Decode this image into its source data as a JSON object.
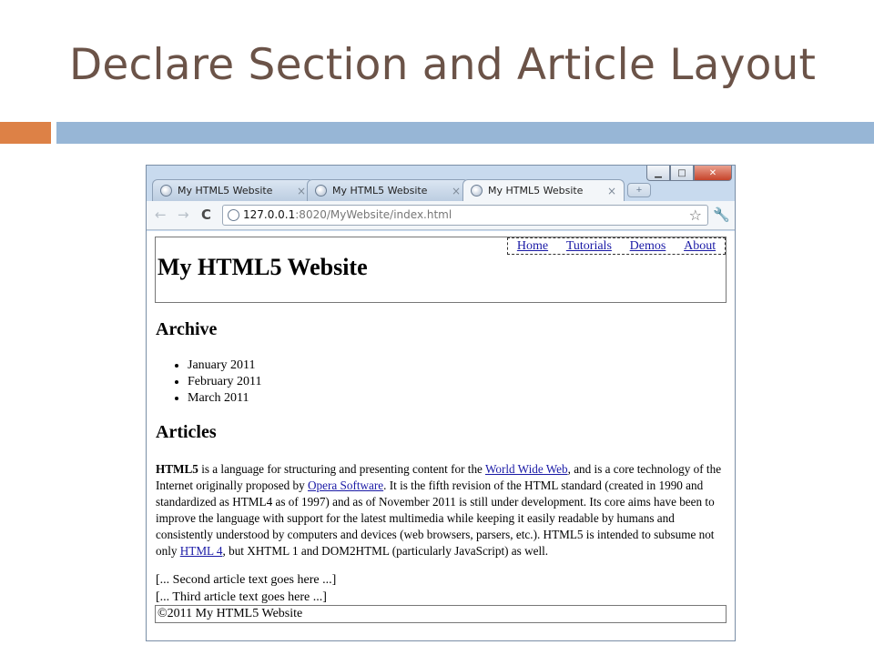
{
  "slide": {
    "title": "Declare Section and Article Layout",
    "colors": {
      "title": "#6b5348",
      "accent_orange": "#dd8146",
      "accent_blue": "#97b6d6"
    }
  },
  "browser": {
    "window_controls": {
      "minimize": "minimize-icon",
      "maximize": "maximize-icon",
      "close": "close-icon"
    },
    "tabs": [
      {
        "label": "My HTML5 Website",
        "active": false,
        "icon": "globe-icon"
      },
      {
        "label": "My HTML5 Website",
        "active": false,
        "icon": "globe-icon"
      },
      {
        "label": "My HTML5 Website",
        "active": true,
        "icon": "globe-icon"
      }
    ],
    "tab_close_glyph": "×",
    "new_tab_glyph": "+",
    "address": {
      "host": "127.0.0.1",
      "rest": ":8020/MyWebsite/index.html"
    },
    "icons": {
      "back": "←",
      "forward": "→",
      "reload": "C",
      "star": "☆",
      "wrench": "🔧"
    }
  },
  "page": {
    "site_title": "My HTML5 Website",
    "nav": [
      "Home",
      "Tutorials",
      "Demos",
      "About"
    ],
    "archive_heading": "Archive",
    "archive_items": [
      "January 2011",
      "February 2011",
      "March 2011"
    ],
    "articles_heading": "Articles",
    "article1": {
      "strong": "HTML5",
      "t1": " is a language for structuring and presenting content for the ",
      "link1": "World Wide Web",
      "t2": ", and is a core technology of the Internet originally proposed by ",
      "link2": "Opera Software",
      "t3": ". It is the fifth revision of the HTML standard (created in 1990 and standardized as HTML4 as of 1997) and as of November 2011 is still under development. Its core aims have been to improve the language with support for the latest multimedia while keeping it easily readable by humans and consistently understood by computers and devices (web browsers, parsers, etc.). HTML5 is intended to subsume not only ",
      "link3": "HTML 4",
      "t4": ", but XHTML 1 and DOM2HTML (particularly JavaScript) as well."
    },
    "article2": "[... Second article text goes here ...]",
    "article3": "[... Third article text goes here ...]",
    "footer": "©2011 My HTML5 Website",
    "link_color": "#1a1aa6"
  }
}
